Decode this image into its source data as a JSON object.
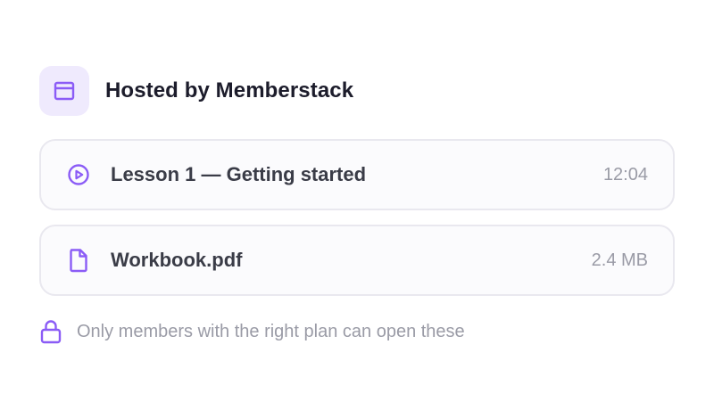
{
  "header": {
    "icon": "window-icon",
    "title": "Hosted by Memberstack"
  },
  "items": [
    {
      "icon": "play-circle-icon",
      "label": "Lesson 1 — Getting started",
      "meta": "12:04"
    },
    {
      "icon": "file-icon",
      "label": "Workbook.pdf",
      "meta": "2.4 MB"
    }
  ],
  "note": {
    "icon": "lock-icon",
    "text": "Only members with the right plan can open these"
  },
  "colors": {
    "accent": "#8b5cf6",
    "accent_bg": "#efeafd",
    "title": "#1c1c2b",
    "label": "#3a3c47",
    "muted": "#9a9ba6",
    "card_border": "#e9e8ef",
    "card_bg": "#fbfbfd"
  }
}
